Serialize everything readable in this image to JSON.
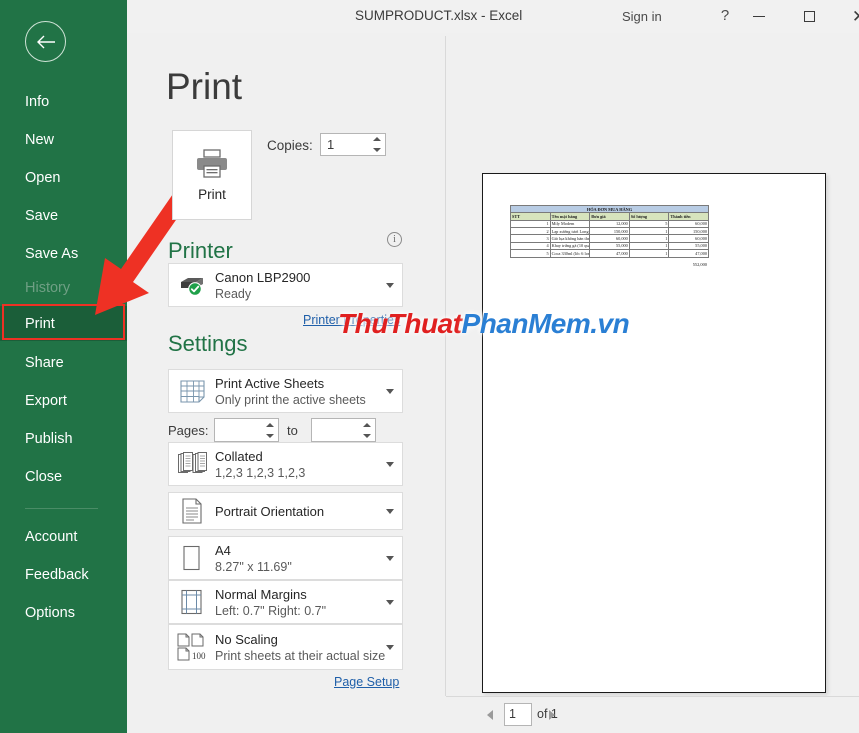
{
  "titlebar": {
    "document_title": "SUMPRODUCT.xlsx  -  Excel",
    "signin_label": "Sign in",
    "help_label": "?",
    "minimize_icon": "minimize-icon",
    "maximize_icon": "maximize-icon",
    "close_label": "✕"
  },
  "sidebar": {
    "back_icon": "back-arrow-icon",
    "items": [
      {
        "label": "Info",
        "state": "normal"
      },
      {
        "label": "New",
        "state": "normal"
      },
      {
        "label": "Open",
        "state": "normal"
      },
      {
        "label": "Save",
        "state": "normal"
      },
      {
        "label": "Save As",
        "state": "normal"
      },
      {
        "label": "History",
        "state": "disabled"
      },
      {
        "label": "Print",
        "state": "active"
      },
      {
        "label": "Share",
        "state": "normal"
      },
      {
        "label": "Export",
        "state": "normal"
      },
      {
        "label": "Publish",
        "state": "normal"
      },
      {
        "label": "Close",
        "state": "normal"
      },
      {
        "label": "Account",
        "state": "normal"
      },
      {
        "label": "Feedback",
        "state": "normal"
      },
      {
        "label": "Options",
        "state": "normal"
      }
    ],
    "background_color": "#217346",
    "active_color": "#1b5e39"
  },
  "annotations": {
    "highlight_color": "#ee3124",
    "highlight_target": "Print",
    "arrow_color": "#ee3124"
  },
  "main": {
    "page_title": "Print",
    "print_button": {
      "label": "Print",
      "icon": "printer-icon"
    },
    "copies": {
      "label": "Copies:",
      "value": "1"
    },
    "printer_section": {
      "heading": "Printer",
      "info_icon": "info-icon",
      "selected": {
        "name": "Canon LBP2900",
        "status": "Ready",
        "icon": "printer-ready-icon"
      },
      "properties_link": "Printer Properties"
    },
    "settings_section": {
      "heading": "Settings",
      "options": [
        {
          "title": "Print Active Sheets",
          "subtitle": "Only print the active sheets",
          "icon": "sheets-icon"
        },
        {
          "title": "Collated",
          "subtitle": "1,2,3   1,2,3   1,2,3",
          "icon": "collate-icon"
        },
        {
          "title": "Portrait Orientation",
          "subtitle": "",
          "icon": "portrait-icon"
        },
        {
          "title": "A4",
          "subtitle": "8.27\" x 11.69\"",
          "icon": "paper-size-icon"
        },
        {
          "title": "Normal Margins",
          "subtitle": "Left:  0.7\"   Right:  0.7\"",
          "icon": "margins-icon"
        },
        {
          "title": "No Scaling",
          "subtitle": "Print sheets at their actual size",
          "icon": "scaling-icon"
        }
      ],
      "pages": {
        "label": "Pages:",
        "from": "",
        "to_label": "to",
        "to": ""
      },
      "page_setup_link": "Page Setup"
    }
  },
  "preview": {
    "watermark": {
      "part1": "ThuThuat",
      "part2": "PhanMem.vn",
      "color1": "#e02020",
      "color2": "#2a7fd4"
    },
    "document": {
      "title": "HÓA ĐƠN MUA HÀNG",
      "headers": [
        "STT",
        "Tên mặt hàng",
        "Đơn giá",
        "Số lượng",
        "Thành tiền"
      ],
      "rows": [
        [
          "1",
          "Mily Modem",
          "12,000",
          "5",
          "60,000"
        ],
        [
          "2",
          "Lạp xưởng tươi Long An (1kg)",
          "150,000",
          "1",
          "150,000"
        ],
        [
          "3",
          "Giò lụa không hàn the",
          "60,000",
          "1",
          "60,000"
        ],
        [
          "4",
          "Khay trứng gà (10 quả)",
          "55,000",
          "1",
          "55,000"
        ],
        [
          "5",
          "Coca 330ml (lốc 6 lon)",
          "47,000",
          "1",
          "47,000"
        ]
      ],
      "total": "552,000"
    }
  },
  "statusbar": {
    "prev_icon": "previous-page-icon",
    "next_icon": "next-page-icon",
    "current_page": "1",
    "page_of": "of 1",
    "show_margins_icon": "show-margins-icon",
    "zoom_to_page_icon": "zoom-to-page-icon"
  }
}
